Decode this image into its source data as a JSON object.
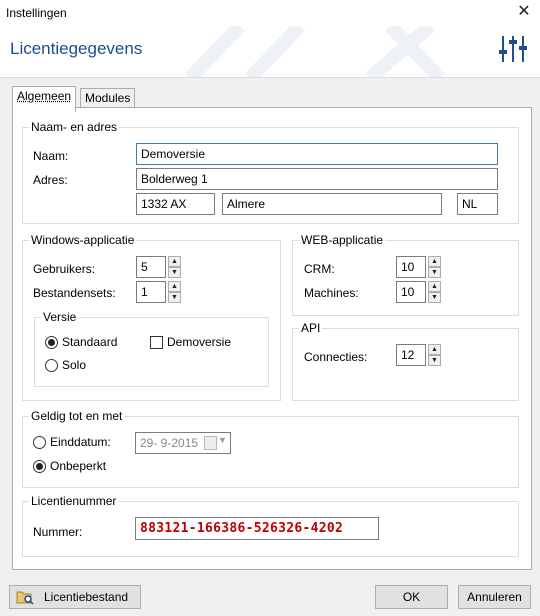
{
  "window": {
    "title": "Instellingen",
    "close_glyph": "✕"
  },
  "header": {
    "heading": "Licentiegegevens",
    "icon": "sliders-icon"
  },
  "tabs": [
    {
      "label": "Algemeen"
    },
    {
      "label": "Modules"
    }
  ],
  "name_address": {
    "legend": "Naam- en adres",
    "name_label": "Naam:",
    "name_value": "Demoversie",
    "address_label": "Adres:",
    "street": "Bolderweg 1",
    "postcode": "1332 AX",
    "city": "Almere",
    "country": "NL"
  },
  "windows_app": {
    "legend": "Windows-applicatie",
    "users_label": "Gebruikers:",
    "users": "5",
    "filesets_label": "Bestandensets:",
    "filesets": "1",
    "version": {
      "legend": "Versie",
      "standard": "Standaard",
      "solo": "Solo",
      "demo": "Demoversie",
      "selected": "Standaard",
      "demo_checked": false
    }
  },
  "web_app": {
    "legend": "WEB-applicatie",
    "crm_label": "CRM:",
    "crm": "10",
    "machines_label": "Machines:",
    "machines": "10"
  },
  "api": {
    "legend": "API",
    "connections_label": "Connecties:",
    "connections": "12"
  },
  "valid_until": {
    "legend": "Geldig tot en met",
    "end_date_label": "Einddatum:",
    "date": "29-  9-2015",
    "unlimited_label": "Onbeperkt",
    "selected": "Onbeperkt"
  },
  "license": {
    "legend": "Licentienummer",
    "number_label": "Nummer:",
    "number": "883121-166386-526326-4202"
  },
  "buttons": {
    "license_file": "Licentiebestand",
    "ok": "OK",
    "cancel": "Annuleren"
  },
  "colors": {
    "heading": "#1f4e8c",
    "license_number": "#c00000",
    "focus_border": "#3c7fb1"
  }
}
